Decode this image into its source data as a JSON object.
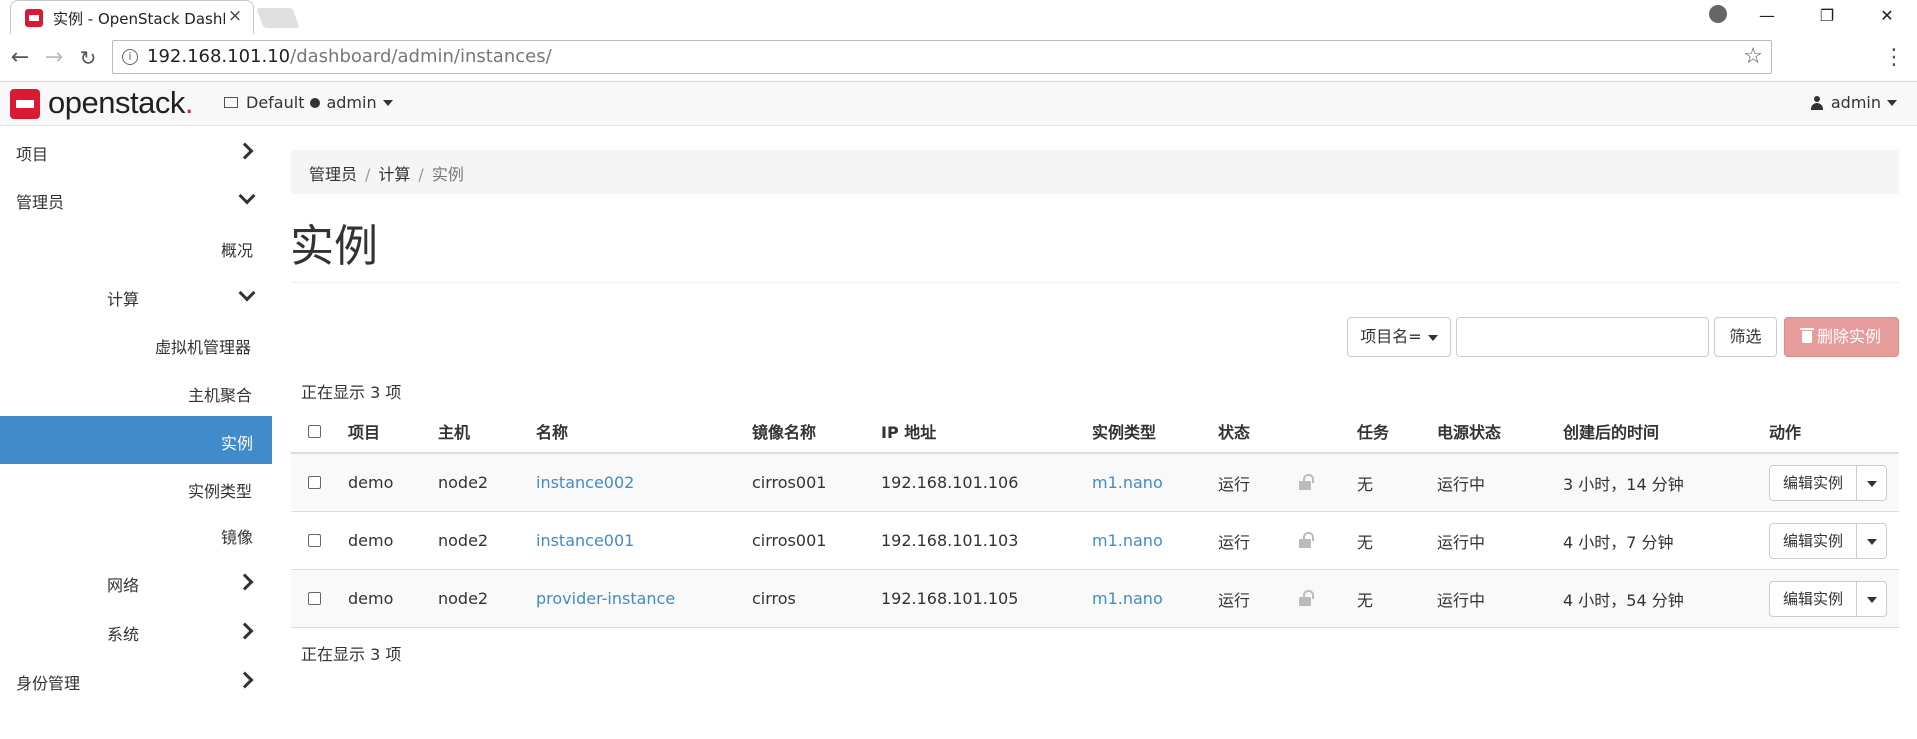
{
  "browser": {
    "tab_title": "实例 - OpenStack Dashboard",
    "tab_close": "×",
    "url_host": "192.168.101.10",
    "url_path": "/dashboard/admin/instances/",
    "icons": [
      "openstack-favicon-icon",
      "close-icon",
      "profile-icon",
      "minimize-icon",
      "maximize-icon",
      "close-window-icon",
      "back-icon",
      "forward-icon",
      "reload-icon",
      "info-icon",
      "star-icon",
      "menu-icon"
    ]
  },
  "navbar": {
    "brand": "openstack",
    "brand_dot": ".",
    "domain": "Default",
    "project": "admin",
    "user": "admin",
    "brand_color": "#da1a32"
  },
  "sidebar": {
    "items": [
      {
        "label": "项目",
        "level": 0,
        "chevron": "right"
      },
      {
        "label": "管理员",
        "level": 0,
        "chevron": "down"
      },
      {
        "label": "概况",
        "level": 1
      },
      {
        "label": "计算",
        "level": 1,
        "chevron": "down"
      },
      {
        "label": "虚拟机管理器",
        "level": 2
      },
      {
        "label": "主机聚合",
        "level": 2
      },
      {
        "label": "实例",
        "level": 2,
        "active": true
      },
      {
        "label": "实例类型",
        "level": 2
      },
      {
        "label": "镜像",
        "level": 2
      },
      {
        "label": "网络",
        "level": 1,
        "chevron": "right"
      },
      {
        "label": "系统",
        "level": 1,
        "chevron": "right"
      },
      {
        "label": "身份管理",
        "level": 0,
        "chevron": "right"
      }
    ],
    "active_color": "#428bca"
  },
  "breadcrumb": [
    "管理员",
    "计算",
    "实例"
  ],
  "breadcrumb_sep": "/",
  "page_title": "实例",
  "filter": {
    "field_label": "项目名=",
    "input_value": "",
    "filter_button": "筛选",
    "delete_button": "删除实例"
  },
  "count_text": "正在显示 3 项",
  "table": {
    "headers": [
      "项目",
      "主机",
      "名称",
      "镜像名称",
      "IP 地址",
      "实例类型",
      "状态",
      "任务",
      "电源状态",
      "创建后的时间",
      "动作"
    ],
    "rows": [
      {
        "project": "demo",
        "host": "node2",
        "name": "instance002",
        "image": "cirros001",
        "ip": "192.168.101.106",
        "flavor": "m1.nano",
        "status": "运行",
        "task": "无",
        "power": "运行中",
        "age": "3 小时，14 分钟",
        "action": "编辑实例"
      },
      {
        "project": "demo",
        "host": "node2",
        "name": "instance001",
        "image": "cirros001",
        "ip": "192.168.101.103",
        "flavor": "m1.nano",
        "status": "运行",
        "task": "无",
        "power": "运行中",
        "age": "4 小时，7 分钟",
        "action": "编辑实例"
      },
      {
        "project": "demo",
        "host": "node2",
        "name": "provider-instance",
        "image": "cirros",
        "ip": "192.168.101.105",
        "flavor": "m1.nano",
        "status": "运行",
        "task": "无",
        "power": "运行中",
        "age": "4 小时，54 分钟",
        "action": "编辑实例"
      }
    ]
  },
  "colors": {
    "link": "#428bca",
    "danger_disabled": "#e69c9b"
  }
}
